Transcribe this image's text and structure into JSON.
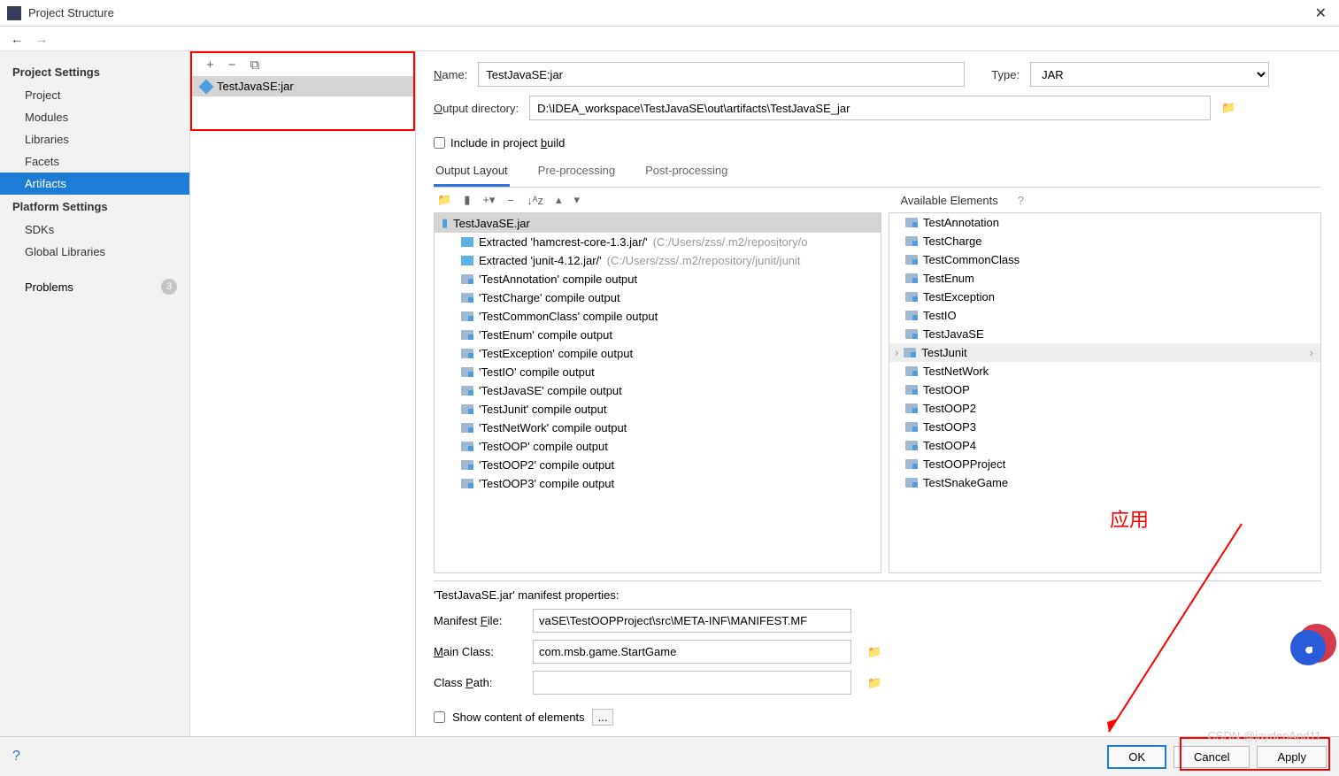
{
  "window": {
    "title": "Project Structure"
  },
  "sidebar": {
    "section1": "Project Settings",
    "items1": [
      "Project",
      "Modules",
      "Libraries",
      "Facets",
      "Artifacts"
    ],
    "section2": "Platform Settings",
    "items2": [
      "SDKs",
      "Global Libraries"
    ],
    "problems": "Problems",
    "problems_count": "3"
  },
  "artifact_list": {
    "item": "TestJavaSE:jar"
  },
  "form": {
    "name_label": "Name:",
    "name_value": "TestJavaSE:jar",
    "type_label": "Type:",
    "type_value": "JAR",
    "outdir_label": "Output directory:",
    "outdir_value": "D:\\IDEA_workspace\\TestJavaSE\\out\\artifacts\\TestJavaSE_jar",
    "include_build": "Include in project build"
  },
  "tabs": [
    "Output Layout",
    "Pre-processing",
    "Post-processing"
  ],
  "avail_label": "Available Elements",
  "tree": {
    "root": "TestJavaSE.jar",
    "items": [
      {
        "t": "extract",
        "label": "Extracted 'hamcrest-core-1.3.jar/'",
        "hint": " (C:/Users/zss/.m2/repository/o"
      },
      {
        "t": "extract",
        "label": "Extracted 'junit-4.12.jar/'",
        "hint": " (C:/Users/zss/.m2/repository/junit/junit"
      },
      {
        "t": "folder",
        "label": "'TestAnnotation' compile output"
      },
      {
        "t": "folder",
        "label": "'TestCharge' compile output"
      },
      {
        "t": "folder",
        "label": "'TestCommonClass' compile output"
      },
      {
        "t": "folder",
        "label": "'TestEnum' compile output"
      },
      {
        "t": "folder",
        "label": "'TestException' compile output"
      },
      {
        "t": "folder",
        "label": "'TestIO' compile output"
      },
      {
        "t": "folder",
        "label": "'TestJavaSE' compile output"
      },
      {
        "t": "folder",
        "label": "'TestJunit' compile output"
      },
      {
        "t": "folder",
        "label": "'TestNetWork' compile output"
      },
      {
        "t": "folder",
        "label": "'TestOOP' compile output"
      },
      {
        "t": "folder",
        "label": "'TestOOP2' compile output"
      },
      {
        "t": "folder",
        "label": "'TestOOP3' compile output"
      }
    ]
  },
  "elements": [
    "TestAnnotation",
    "TestCharge",
    "TestCommonClass",
    "TestEnum",
    "TestException",
    "TestIO",
    "TestJavaSE",
    "TestJunit",
    "TestNetWork",
    "TestOOP",
    "TestOOP2",
    "TestOOP3",
    "TestOOP4",
    "TestOOPProject",
    "TestSnakeGame"
  ],
  "manifest": {
    "title": "'TestJavaSE.jar' manifest properties:",
    "file_label": "Manifest File:",
    "file_value": "vaSE\\TestOOPProject\\src\\META-INF\\MANIFEST.MF",
    "main_label": "Main Class:",
    "main_value": "com.msb.game.StartGame",
    "classpath_label": "Class Path:",
    "classpath_value": ""
  },
  "show_content": "Show content of elements",
  "buttons": {
    "ok": "OK",
    "cancel": "Cancel",
    "apply": "Apply"
  },
  "annotation": "应用",
  "watermark": "CSDN @jaydenAnd11"
}
